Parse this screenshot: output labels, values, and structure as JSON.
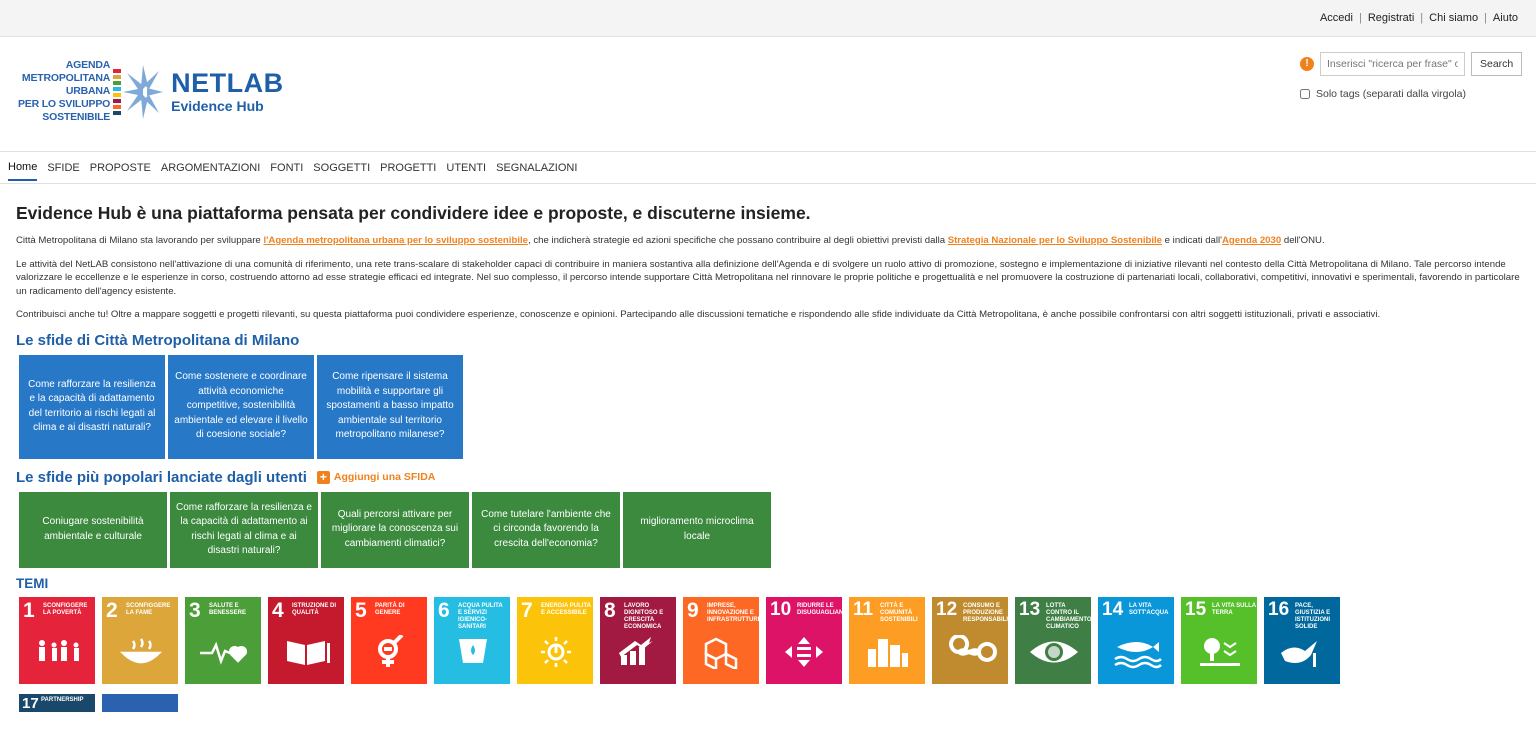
{
  "topbar": {
    "links": [
      "Accedi",
      "Registrati",
      "Chi siamo",
      "Aiuto"
    ]
  },
  "logo": {
    "lines": [
      "AGENDA",
      "METROPOLITANA",
      "URBANA",
      "PER LO SVILUPPO",
      "SOSTENIBILE"
    ],
    "title": "NETLAB",
    "subtitle": "Evidence Hub"
  },
  "search": {
    "placeholder": "Inserisci \"ricerca per frase\" o",
    "button": "Search",
    "tags_label": "Solo tags (separati dalla virgola)"
  },
  "nav": {
    "items": [
      "Home",
      "SFIDE",
      "PROPOSTE",
      "ARGOMENTAZIONI",
      "FONTI",
      "SOGGETTI",
      "PROGETTI",
      "UTENTI",
      "SEGNALAZIONI"
    ],
    "active": "Home"
  },
  "intro": {
    "title": "Evidence Hub è una piattaforma pensata per condividere idee e proposte, e discuterne insieme.",
    "p1_a": "Città Metropolitana di Milano sta lavorando per sviluppare ",
    "p1_link1": "l'Agenda metropolitana urbana per lo sviluppo sostenibile",
    "p1_b": ", che indicherà strategie ed azioni specifiche che possano contribuire al degli obiettivi previsti dalla ",
    "p1_link2": "Strategia Nazionale per lo Sviluppo Sostenibile",
    "p1_c": " e indicati dall'",
    "p1_link3": "Agenda 2030",
    "p1_d": " dell'ONU.",
    "p2": "Le attività del NetLAB consistono nell'attivazione di una comunità di riferimento, una rete trans-scalare di stakeholder capaci di contribuire in maniera sostantiva alla definizione dell'Agenda e di svolgere un ruolo attivo di promozione, sostegno e implementazione di iniziative rilevanti nel contesto della Città Metropolitana di Milano. Tale percorso intende valorizzare le eccellenze e le esperienze in corso, costruendo attorno ad esse strategie efficaci ed integrate. Nel suo complesso, il percorso intende supportare Città Metropolitana nel rinnovare le proprie politiche e progettualità e nel promuovere la costruzione di partenariati locali, collaborativi, competitivi, innovativi e sperimentali, favorendo in particolare un radicamento dell'agency esistente.",
    "p3": "Contribuisci anche tu! Oltre a mappare soggetti e progetti rilevanti, su questa piattaforma puoi condividere esperienze, conoscenze e opinioni. Partecipando alle discussioni tematiche e rispondendo alle sfide individuate da Città Metropolitana, è anche possibile confrontarsi con altri soggetti istituzionali, privati e associativi."
  },
  "sfide_cm": {
    "title": "Le sfide di Città Metropolitana di Milano",
    "cards": [
      "Come rafforzare la resilienza e la capacità di adattamento del territorio ai rischi legati al clima e ai disastri naturali?",
      "Come sostenere e coordinare attività economiche competitive, sostenibilità ambientale ed elevare il livello di coesione sociale?",
      "Come ripensare il sistema mobilità e supportare gli spostamenti a basso impatto ambientale sul territorio metropolitano milanese?"
    ]
  },
  "sfide_utenti": {
    "title": "Le sfide più popolari lanciate dagli utenti",
    "add_label": "Aggiungi una SFIDA",
    "cards": [
      "Coniugare sostenibilità ambientale e culturale",
      "Come rafforzare la resilienza e la capacità di adattamento ai rischi legati al clima e ai disastri naturali?",
      "Quali percorsi attivare per migliorare la conoscenza sui cambiamenti climatici?",
      "Come tutelare l'ambiente che ci circonda favorendo la crescita dell'economia?",
      "miglioramento microclima locale"
    ]
  },
  "temi": {
    "title": "TEMI",
    "goals": [
      {
        "num": "1",
        "label": "SCONFIGGERE LA POVERTÀ",
        "color": "#e5243b",
        "icon": "family-icon"
      },
      {
        "num": "2",
        "label": "SCONFIGGERE LA FAME",
        "color": "#dda63a",
        "icon": "bowl-icon"
      },
      {
        "num": "3",
        "label": "SALUTE E BENESSERE",
        "color": "#4c9f38",
        "icon": "heartbeat-icon"
      },
      {
        "num": "4",
        "label": "ISTRUZIONE DI QUALITÀ",
        "color": "#c5192d",
        "icon": "book-icon"
      },
      {
        "num": "5",
        "label": "PARITÀ DI GENERE",
        "color": "#ff3a21",
        "icon": "gender-icon"
      },
      {
        "num": "6",
        "label": "ACQUA PULITA E SERVIZI IGIENICO-SANITARI",
        "color": "#26bde2",
        "icon": "water-icon"
      },
      {
        "num": "7",
        "label": "ENERGIA PULITA E ACCESSIBILE",
        "color": "#fcc30b",
        "icon": "sun-icon"
      },
      {
        "num": "8",
        "label": "LAVORO DIGNITOSO E CRESCITA ECONOMICA",
        "color": "#a21942",
        "icon": "growth-icon"
      },
      {
        "num": "9",
        "label": "IMPRESE, INNOVAZIONE E INFRASTRUTTURE",
        "color": "#fd6925",
        "icon": "cubes-icon"
      },
      {
        "num": "10",
        "label": "RIDURRE LE DISUGUAGLIANZE",
        "color": "#dd1367",
        "icon": "equality-icon"
      },
      {
        "num": "11",
        "label": "CITTÀ E COMUNITÀ SOSTENIBILI",
        "color": "#fd9d24",
        "icon": "city-icon"
      },
      {
        "num": "12",
        "label": "CONSUMO E PRODUZIONE RESPONSABILI",
        "color": "#bf8b2e",
        "icon": "infinity-icon"
      },
      {
        "num": "13",
        "label": "LOTTA CONTRO IL CAMBIAMENTO CLIMATICO",
        "color": "#3f7e44",
        "icon": "eye-globe-icon"
      },
      {
        "num": "14",
        "label": "LA VITA SOTT'ACQUA",
        "color": "#0a97d9",
        "icon": "fish-icon"
      },
      {
        "num": "15",
        "label": "LA VITA SULLA TERRA",
        "color": "#56c02b",
        "icon": "tree-icon"
      },
      {
        "num": "16",
        "label": "PACE, GIUSTIZIA E ISTITUZIONI SOLIDE",
        "color": "#00689d",
        "icon": "dove-icon"
      }
    ],
    "goal17": {
      "num": "17",
      "label": "PARTNERSHIP",
      "color": "#19486a"
    }
  }
}
